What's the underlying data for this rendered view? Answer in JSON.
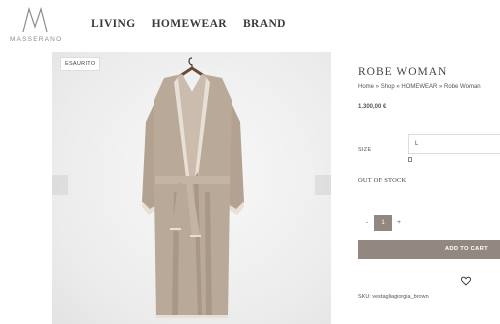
{
  "brand": {
    "logo_text": "MASSERANO"
  },
  "nav": {
    "items": [
      "LIVING",
      "HOMEWEAR",
      "BRAND"
    ]
  },
  "gallery": {
    "badge": "ESAURITO"
  },
  "product": {
    "title": "ROBE WOMAN",
    "breadcrumb": {
      "home": "Home",
      "shop": "Shop",
      "category": "HOMEWEAR",
      "current": "Robe Woman",
      "separator": " » "
    },
    "price": "1.300,00 €",
    "size_label": "SIZE",
    "size_value": "L",
    "stock_status": "OUT OF STOCK",
    "quantity": "1",
    "qty_minus": "-",
    "qty_plus": "+",
    "add_to_cart_label": "ADD TO CART",
    "sku_label": "SKU:",
    "sku_value": "vestagliagiorgia_brown"
  },
  "colors": {
    "accent": "#938782",
    "robe": "#b9a998",
    "robe_trim": "#e8e0d6"
  }
}
